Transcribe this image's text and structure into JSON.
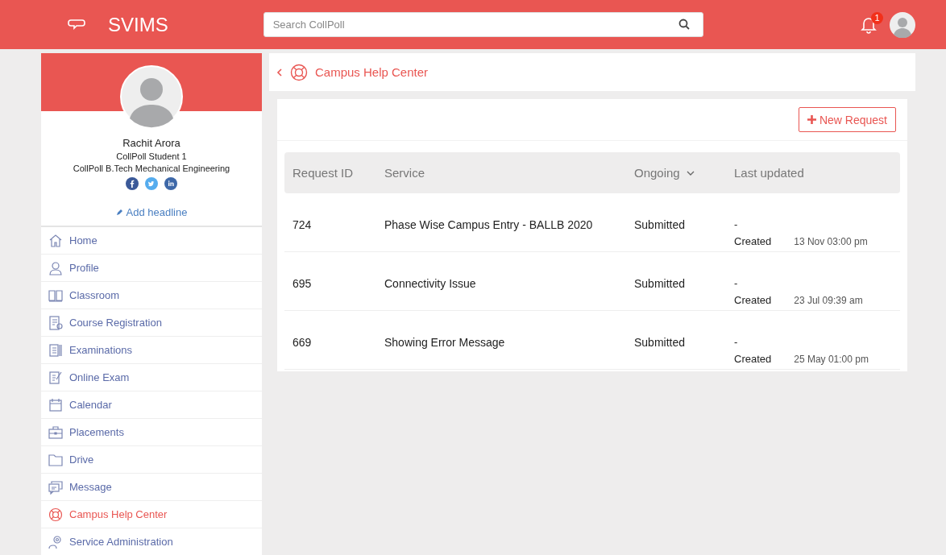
{
  "app": {
    "name": "SVIMS"
  },
  "search": {
    "placeholder": "Search CollPoll"
  },
  "notifications": {
    "count": "1"
  },
  "profile": {
    "name": "Rachit Arora",
    "role": "CollPoll Student 1",
    "program": "CollPoll B.Tech Mechanical Engineering",
    "headline_link": "Add headline"
  },
  "sidebar": {
    "items": [
      {
        "label": "Home",
        "selected": false
      },
      {
        "label": "Profile",
        "selected": false
      },
      {
        "label": "Classroom",
        "selected": false
      },
      {
        "label": "Course Registration",
        "selected": false
      },
      {
        "label": "Examinations",
        "selected": false
      },
      {
        "label": "Online Exam",
        "selected": false
      },
      {
        "label": "Calendar",
        "selected": false
      },
      {
        "label": "Placements",
        "selected": false
      },
      {
        "label": "Drive",
        "selected": false
      },
      {
        "label": "Message",
        "selected": false
      },
      {
        "label": "Campus Help Center",
        "selected": true
      },
      {
        "label": "Service Administration",
        "selected": false
      }
    ]
  },
  "page": {
    "title": "Campus Help Center",
    "new_button": "New Request"
  },
  "table": {
    "columns": [
      "Request ID",
      "Service",
      "Ongoing",
      "Last updated"
    ],
    "rows": [
      {
        "id": "724",
        "service": "Phase Wise Campus Entry - BALLB 2020",
        "status": "Submitted",
        "updated": "-",
        "event": "Created",
        "date": "13 Nov 03:00 pm"
      },
      {
        "id": "695",
        "service": "Connectivity Issue",
        "status": "Submitted",
        "updated": "-",
        "event": "Created",
        "date": "23 Jul 09:39 am"
      },
      {
        "id": "669",
        "service": "Showing Error Message",
        "status": "Submitted",
        "updated": "-",
        "event": "Created",
        "date": "25 May 01:00 pm"
      }
    ]
  }
}
